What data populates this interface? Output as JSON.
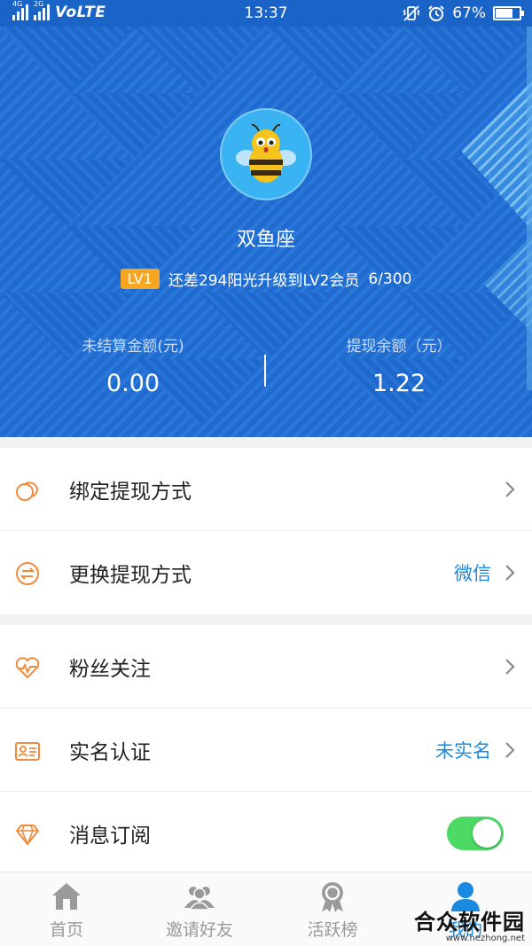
{
  "status_bar": {
    "network_1": "4G",
    "network_2": "2G",
    "volte": "VoLTE",
    "time": "13:37",
    "battery_text": "67%",
    "battery_level": 0.67
  },
  "profile": {
    "nickname": "双鱼座",
    "level_badge": "LV1",
    "level_text": "还差294阳光升级到LV2会员",
    "progress_text": "6/300",
    "stats": [
      {
        "label": "未结算金额(元)",
        "value": "0.00"
      },
      {
        "label": "提现余额（元）",
        "value": "1.22"
      }
    ]
  },
  "menu_groups": [
    {
      "items": [
        {
          "label": "绑定提现方式",
          "value": "",
          "icon": "coins-icon"
        },
        {
          "label": "更换提现方式",
          "value": "微信",
          "icon": "exchange-icon"
        }
      ]
    },
    {
      "items": [
        {
          "label": "粉丝关注",
          "value": "",
          "icon": "heartbeat-icon"
        },
        {
          "label": "实名认证",
          "value": "未实名",
          "icon": "id-card-icon"
        },
        {
          "label": "消息订阅",
          "value": "",
          "icon": "diamond-icon",
          "toggle_on": true
        }
      ]
    }
  ],
  "tabs": [
    {
      "label": "首页",
      "icon": "home-icon",
      "active": false
    },
    {
      "label": "邀请好友",
      "icon": "friends-icon",
      "active": false
    },
    {
      "label": "活跃榜",
      "icon": "medal-icon",
      "active": false
    },
    {
      "label": "我的",
      "icon": "user-icon",
      "active": true
    }
  ],
  "watermark": {
    "main": "合众软件园",
    "sub": "www.hezhong.net"
  },
  "colors": {
    "hero_blue": "#1f6bd0",
    "accent_blue": "#1a8ae0",
    "orange": "#f08a3c",
    "badge": "#f5a623",
    "toggle_green": "#4cd964"
  }
}
